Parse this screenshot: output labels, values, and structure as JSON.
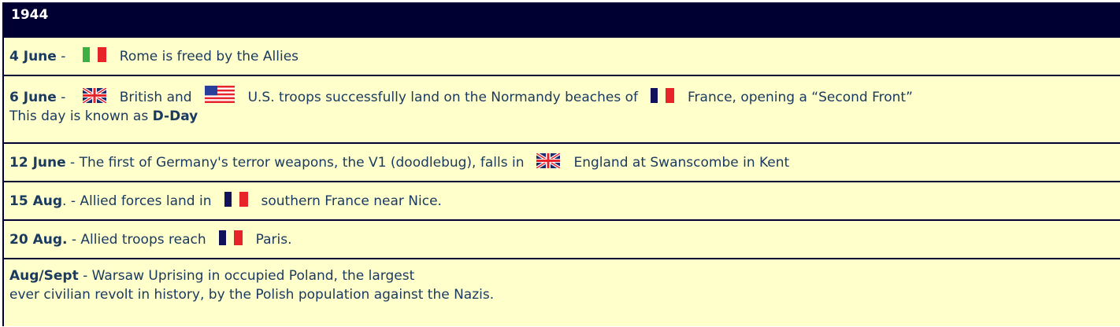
{
  "year": "1944",
  "events": [
    {
      "date": "4 June",
      "sep": " - ",
      "flag1": "italy-flag",
      "text1": "Rome is freed by the Allies"
    },
    {
      "date": "6 June",
      "sep": " - ",
      "flag1": "uk-flag",
      "text1": "British and",
      "flag2": "us-flag",
      "text2": "U.S. troops successfully land on the Normandy beaches of",
      "flag3": "france-flag",
      "text3": "France, opening a “Second Front”",
      "line2_prefix": "This day is known as ",
      "line2_bold": "D-Day"
    },
    {
      "date": "12 June",
      "sep": " - The first of Germany's terror weapons, the V1 (doodlebug), falls in",
      "flag1": "uk-flag",
      "text1": "England at Swanscombe in Kent"
    },
    {
      "date": "15 Aug",
      "sep": ". - Allied forces land in",
      "flag1": "france-flag",
      "text1": "southern France near Nice."
    },
    {
      "date": "20 Aug.",
      "sep": " - Allied troops reach",
      "flag1": "france-flag",
      "text1": "Paris."
    },
    {
      "date": "Aug/Sept",
      "sep": " - Warsaw Uprising in occupied Poland, the largest",
      "line2": "ever civilian revolt in history, by the Polish population against the Nazis."
    }
  ],
  "colors": {
    "header_bg": "#000033",
    "row_bg": "#ffffcc",
    "text": "#1a3a60"
  }
}
